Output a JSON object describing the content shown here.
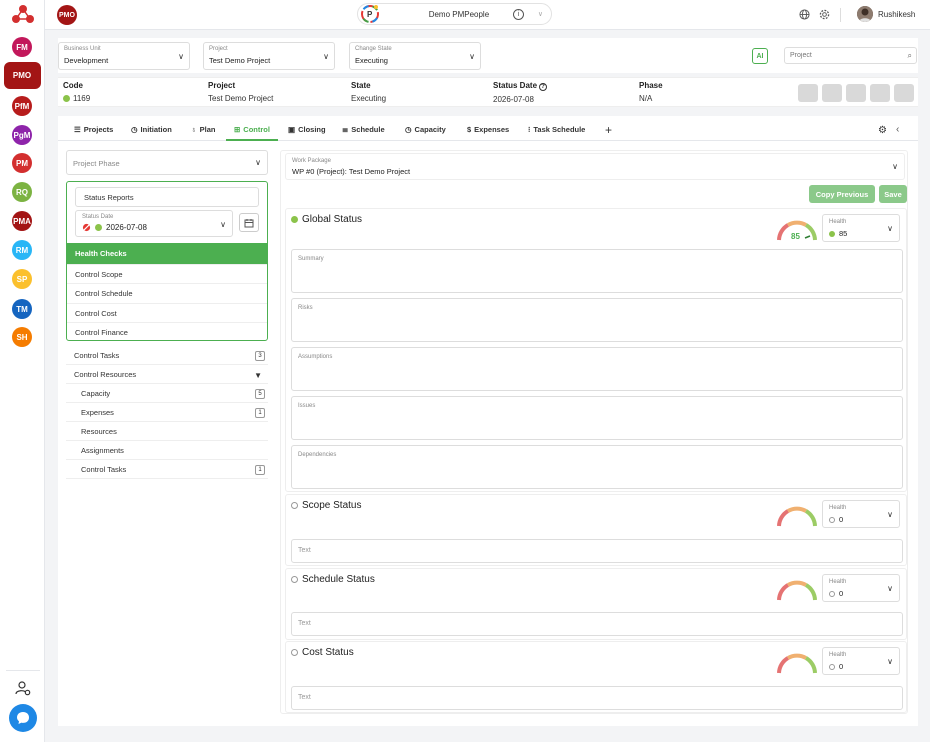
{
  "sidebar": {
    "items": [
      {
        "label": "FM",
        "color": "#c2185b"
      },
      {
        "label": "PMO",
        "color": "#a31515"
      },
      {
        "label": "PfM",
        "color": "#b71c1c"
      },
      {
        "label": "PgM",
        "color": "#8e24aa"
      },
      {
        "label": "PM",
        "color": "#d32f2f"
      },
      {
        "label": "RQ",
        "color": "#7cb342"
      },
      {
        "label": "PMA",
        "color": "#a31515"
      },
      {
        "label": "RM",
        "color": "#29b6f6"
      },
      {
        "label": "SP",
        "color": "#fbc02d"
      },
      {
        "label": "TM",
        "color": "#1565c0"
      },
      {
        "label": "SH",
        "color": "#f57c00"
      }
    ]
  },
  "topbar": {
    "avatar_label": "PMO",
    "environment": "Demo PMPeople",
    "info_mark": "i",
    "user_name": "Rushikesh"
  },
  "filters": {
    "business_unit": {
      "label": "Business Unit",
      "value": "Development"
    },
    "project": {
      "label": "Project",
      "value": "Test Demo Project"
    },
    "change_state": {
      "label": "Change State",
      "value": "Executing"
    },
    "ai_label": "AI",
    "search_placeholder": "Project"
  },
  "info": {
    "code": {
      "label": "Code",
      "value": "1169"
    },
    "project": {
      "label": "Project",
      "value": "Test Demo Project"
    },
    "state": {
      "label": "State",
      "value": "Executing"
    },
    "status_date": {
      "label": "Status Date",
      "value": "2026-07-08",
      "help_mark": "?"
    },
    "phase": {
      "label": "Phase",
      "value": "N/A"
    }
  },
  "tabs": [
    {
      "label": "Projects",
      "icon": "list-icon"
    },
    {
      "label": "Initiation",
      "icon": "clock-icon"
    },
    {
      "label": "Plan",
      "icon": "bulb-icon"
    },
    {
      "label": "Control",
      "icon": "control-icon"
    },
    {
      "label": "Closing",
      "icon": "folder-icon"
    },
    {
      "label": "Schedule",
      "icon": "schedule-icon"
    },
    {
      "label": "Capacity",
      "icon": "clock-icon"
    },
    {
      "label": "Expenses",
      "icon": "dollar-icon"
    },
    {
      "label": "Task Schedule",
      "icon": "tasks-icon"
    }
  ],
  "left_panel": {
    "phase_placeholder": "Project Phase",
    "status_reports": "Status Reports",
    "status_date_label": "Status Date",
    "status_date_value": "2026-07-08",
    "menu": [
      "Health Checks",
      "Control Scope",
      "Control Schedule",
      "Control Cost",
      "Control Finance"
    ],
    "list": [
      {
        "label": "Control Tasks",
        "count": "3"
      },
      {
        "label": "Control Resources",
        "caret": "▼"
      },
      {
        "label": "Capacity",
        "count": "5"
      },
      {
        "label": "Expenses",
        "count": "1"
      },
      {
        "label": "Resources"
      },
      {
        "label": "Assignments"
      },
      {
        "label": "Control Tasks",
        "count": "1"
      }
    ]
  },
  "right_panel": {
    "work_package_label": "Work Package",
    "work_package_value": "WP #0 (Project): Test Demo Project",
    "copy_previous": "Copy Previous",
    "save": "Save",
    "global_status": {
      "title": "Global Status",
      "gauge_value": "85",
      "health_label": "Health",
      "health_value": "85",
      "fields": [
        "Summary",
        "Risks",
        "Assumptions",
        "Issues",
        "Dependencies"
      ]
    },
    "scope_status": {
      "title": "Scope Status",
      "health_label": "Health",
      "health_value": "0",
      "text_placeholder": "Text"
    },
    "schedule_status": {
      "title": "Schedule Status",
      "health_label": "Health",
      "health_value": "0",
      "text_placeholder": "Text"
    },
    "cost_status": {
      "title": "Cost Status",
      "health_label": "Health",
      "health_value": "0",
      "text_placeholder": "Text"
    }
  },
  "colors": {
    "accent": "#4caf50",
    "brand": "#a31515",
    "button_disabled": "#8bc98a"
  }
}
